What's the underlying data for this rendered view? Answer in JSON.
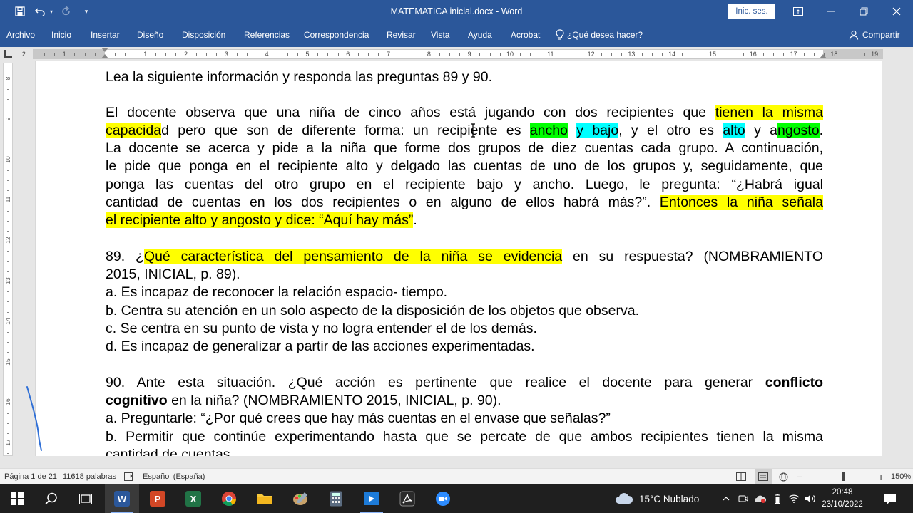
{
  "window": {
    "title": "MATEMATICA inicial.docx - Word",
    "signin_label": "Inic. ses."
  },
  "ribbon": {
    "tabs": [
      "Archivo",
      "Inicio",
      "Insertar",
      "Diseño",
      "Disposición",
      "Referencias",
      "Correspondencia",
      "Revisar",
      "Vista",
      "Ayuda",
      "Acrobat"
    ],
    "search_label": "¿Qué desea hacer?",
    "share_label": "Compartir"
  },
  "ruler": {
    "h_left_numbers": [
      "2",
      "1"
    ],
    "h_numbers": [
      "1",
      "2",
      "3",
      "4",
      "5",
      "6",
      "7",
      "8",
      "9",
      "10",
      "11",
      "12",
      "13",
      "14",
      "15",
      "16",
      "17",
      "18",
      "19"
    ],
    "v_numbers": [
      "8",
      "9",
      "10",
      "11",
      "12",
      "13",
      "14",
      "15",
      "16",
      "17"
    ]
  },
  "document": {
    "intro": "Lea la siguiente información y responda las preguntas 89 y 90.",
    "p1_l1_a": "El docente observa que una niña de cinco años está jugando con dos recipientes que ",
    "p1_l1_hl": "tienen la misma",
    "p1_l2_hl1": "capacida",
    "p1_l2_a": "d pero que son de diferente forma: un recipiente es ",
    "p1_l2_hl2": "ancho",
    "p1_l2_sp": " ",
    "p1_l2_hl3": "y bajo",
    "p1_l2_b": ", y el otro es ",
    "p1_l2_hl4": "alto",
    "p1_l2_c": " y a",
    "p1_l2_hl5": "ngosto",
    "p1_l2_d": ".",
    "p1_l3": "La docente se acerca y pide a la niña que forme dos grupos de diez cuentas cada grupo. A continuación,",
    "p1_l4": "le pide que ponga en el recipiente alto y delgado las cuentas de uno de los grupos y, seguidamente, que",
    "p1_l5": "ponga las cuentas del otro grupo en el recipiente bajo y ancho. Luego, le pregunta: “¿Habrá igual",
    "p1_l6_a": "cantidad de cuentas en los dos recipientes o en alguno de ellos habrá más?”. ",
    "p1_l6_hl": "Entonces la niña señala",
    "p1_l7_hl": "el recipiente alto y angosto y dice: “Aquí hay más”",
    "p1_l7_a": ".",
    "q89_l1_a": "89. ¿",
    "q89_l1_hl": "Qué característica del pensamiento de la niña se evidencia",
    "q89_l1_b": " en su respuesta? (NOMBRAMIENTO",
    "q89_l2": "2015, INICIAL, p. 89).",
    "q89_a": "a. Es incapaz de reconocer la relación espacio- tiempo.",
    "q89_b": "b. Centra su atención en un solo aspecto de la disposición de los objetos que observa.",
    "q89_c": "c. Se centra en su punto de vista y no logra entender el de los demás.",
    "q89_d": "d. Es incapaz de generalizar a partir de las acciones experimentadas.",
    "q90_l1_a": "90. Ante esta situación. ¿Qué acción es pertinente que realice el docente para generar ",
    "q90_l1_b": "conflicto",
    "q90_l2_b": "cognitivo",
    "q90_l2_a": " en la niña? (NOMBRAMIENTO 2015, INICIAL, p. 90).",
    "q90_a": "a. Preguntarle: “¿Por qué crees que hay más cuentas en el envase que señalas?”",
    "q90_b_l1": "b. Permitir que continúe experimentando hasta que se percate de que ambos recipientes tienen la misma",
    "q90_b_l2": "cantidad de cuentas."
  },
  "status": {
    "page": "Página 1 de 21",
    "words": "11618 palabras",
    "language": "Español (España)",
    "zoom": "150%"
  },
  "taskbar": {
    "weather": "15°C  Nublado",
    "time": "20:48",
    "date": "23/10/2022"
  },
  "colors": {
    "word_blue": "#2b579a",
    "highlight_yellow": "#ffff00",
    "highlight_green": "#00ff00",
    "highlight_cyan": "#00ffff"
  }
}
